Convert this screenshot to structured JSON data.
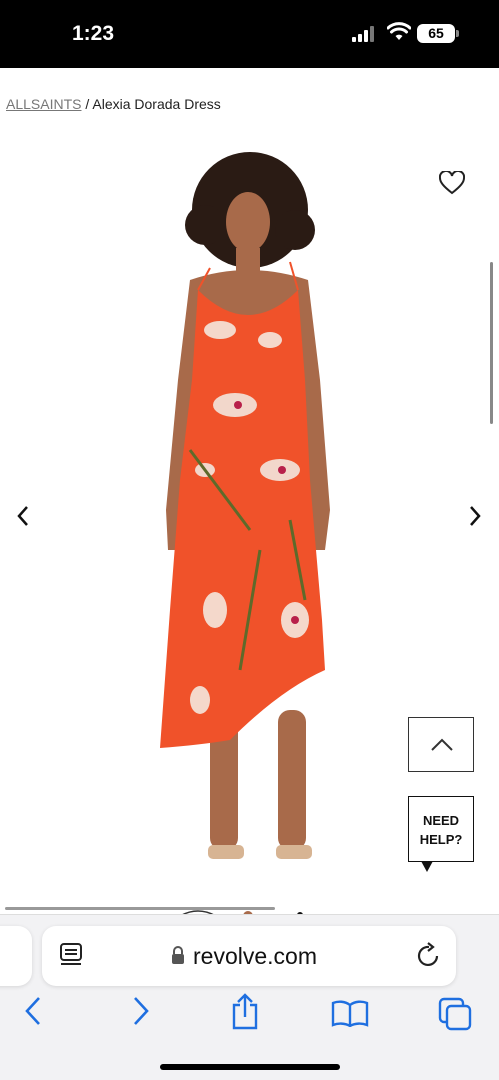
{
  "status_bar": {
    "time": "1:23",
    "battery": "65"
  },
  "breadcrumb": {
    "brand": "ALLSAINTS",
    "separator": " / ",
    "product": "Alexia Dorada Dress"
  },
  "product_image": {
    "alt": "Woman wearing an orange floral satin slip dress"
  },
  "help": {
    "label_line1": "NEED",
    "label_line2": "HELP?"
  },
  "browser": {
    "url": "revolve.com"
  },
  "colors": {
    "accent": "#1f6fe0",
    "dress": "#f0522a"
  }
}
